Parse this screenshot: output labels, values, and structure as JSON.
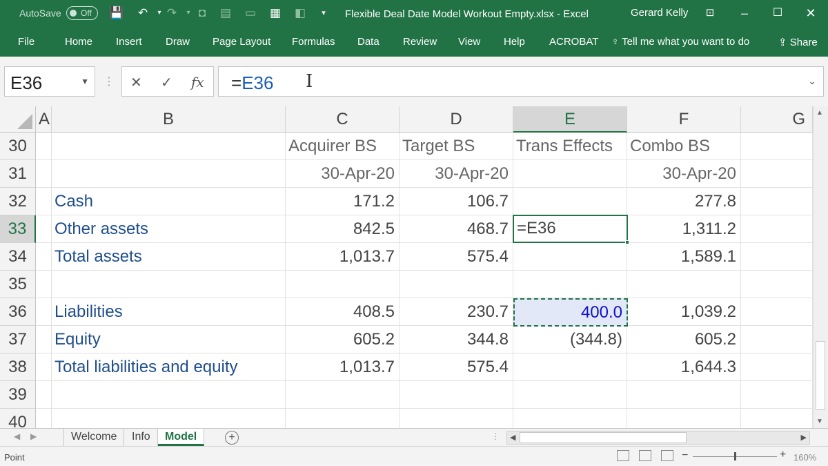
{
  "titlebar": {
    "autosave_label": "AutoSave",
    "autosave_state": "Off",
    "doc_title": "Flexible Deal Date Model Workout Empty.xlsx  -  Excel",
    "user": "Gerard Kelly"
  },
  "ribbon": {
    "tabs": [
      "File",
      "Home",
      "Insert",
      "Draw",
      "Page Layout",
      "Formulas",
      "Data",
      "Review",
      "View",
      "Help",
      "ACROBAT"
    ],
    "tell_me": "Tell me what you want to do",
    "share": "Share"
  },
  "formula_bar": {
    "name_box": "E36",
    "cancel": "✕",
    "enter": "✓",
    "fx": "fx",
    "formula_eq": "=",
    "formula_ref": "E36"
  },
  "columns": [
    "A",
    "B",
    "C",
    "D",
    "E",
    "F",
    "G"
  ],
  "rows": [
    "30",
    "31",
    "32",
    "33",
    "34",
    "35",
    "36",
    "37",
    "38",
    "39",
    "40"
  ],
  "cells": {
    "r30": {
      "C": "Acquirer BS",
      "D": "Target BS",
      "E": "Trans Effects",
      "F": "Combo BS"
    },
    "r31": {
      "C": "30-Apr-20",
      "D": "30-Apr-20",
      "F": "30-Apr-20"
    },
    "r32": {
      "B": "Cash",
      "C": "171.2",
      "D": "106.7",
      "F": "277.8"
    },
    "r33": {
      "B": "Other assets",
      "C": "842.5",
      "D": "468.7",
      "E": "=E36",
      "F": "1,311.2"
    },
    "r34": {
      "B": "Total assets",
      "C": "1,013.7",
      "D": "575.4",
      "F": "1,589.1"
    },
    "r36": {
      "B": "Liabilities",
      "C": "408.5",
      "D": "230.7",
      "E": "400.0",
      "F": "1,039.2"
    },
    "r37": {
      "B": "Equity",
      "C": "605.2",
      "D": "344.8",
      "E": "(344.8)",
      "F": "605.2"
    },
    "r38": {
      "B": "Total liabilities and equity",
      "C": "1,013.7",
      "D": "575.4",
      "F": "1,644.3"
    }
  },
  "sheets": {
    "tabs": [
      "Welcome",
      "Info",
      "Model"
    ],
    "active": "Model"
  },
  "status": {
    "mode": "Point",
    "zoom": "160%"
  }
}
